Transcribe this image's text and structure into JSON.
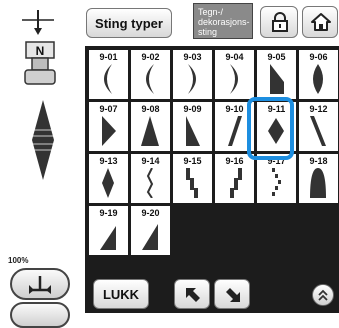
{
  "header": {
    "stitch_types_label": "Sting typer",
    "char_deco_label_line1": "Tegn-/",
    "char_deco_label_line2": "dekorasjons-",
    "char_deco_label_line3": "sting"
  },
  "left": {
    "zoom_label": "100%"
  },
  "stitches": [
    {
      "code": "9-01",
      "shape": "crescent-l"
    },
    {
      "code": "9-02",
      "shape": "crescent-l"
    },
    {
      "code": "9-03",
      "shape": "crescent-r"
    },
    {
      "code": "9-04",
      "shape": "crescent-r"
    },
    {
      "code": "9-05",
      "shape": "corner"
    },
    {
      "code": "9-06",
      "shape": "almond"
    },
    {
      "code": "9-07",
      "shape": "wedge-r"
    },
    {
      "code": "9-08",
      "shape": "triangle"
    },
    {
      "code": "9-09",
      "shape": "right-tri"
    },
    {
      "code": "9-10",
      "shape": "slant-r"
    },
    {
      "code": "9-11",
      "shape": "diamond"
    },
    {
      "code": "9-12",
      "shape": "slant-l"
    },
    {
      "code": "9-13",
      "shape": "diamond-tall"
    },
    {
      "code": "9-14",
      "shape": "zigzag-thin"
    },
    {
      "code": "9-15",
      "shape": "steps"
    },
    {
      "code": "9-16",
      "shape": "steps-r"
    },
    {
      "code": "9-17",
      "shape": "dotted"
    },
    {
      "code": "9-18",
      "shape": "dome"
    },
    {
      "code": "9-19",
      "shape": "ramp"
    },
    {
      "code": "9-20",
      "shape": "ramp-l"
    }
  ],
  "selected_code": "9-11",
  "footer": {
    "close_label": "LUKK"
  }
}
